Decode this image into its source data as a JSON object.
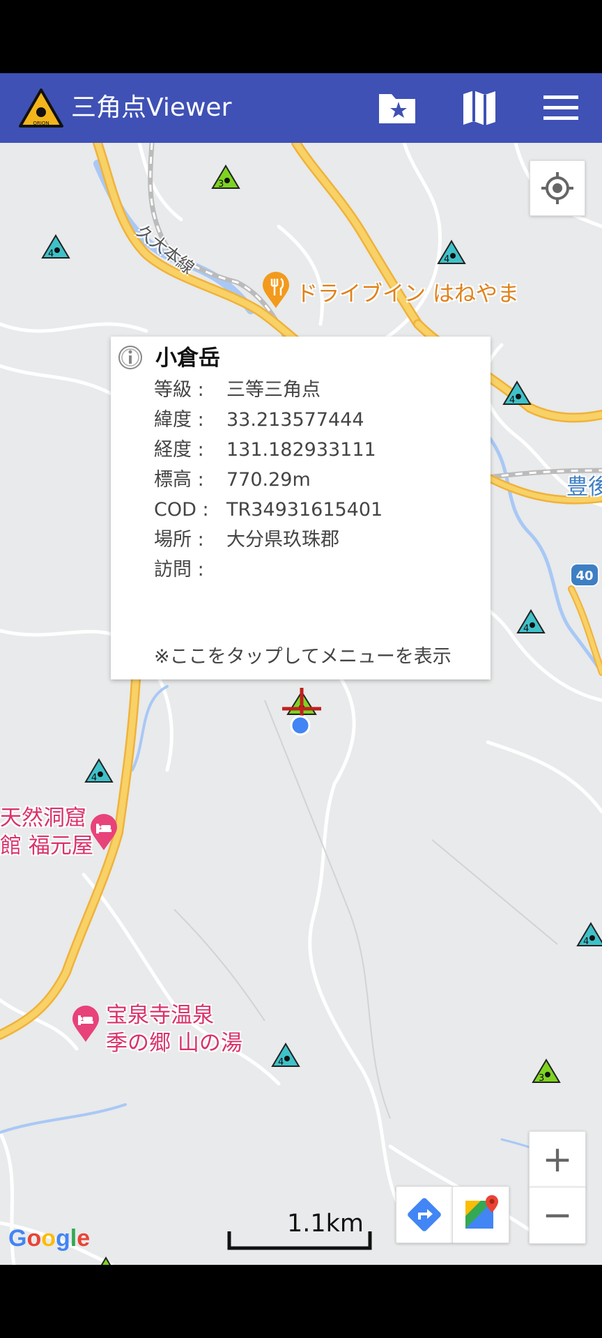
{
  "app": {
    "title": "三角点Viewer",
    "logo_text": "ORION",
    "icons": {
      "bookmarks": "folder-star-icon",
      "map": "map-icon",
      "menu": "hamburger-menu-icon"
    }
  },
  "map": {
    "poi": {
      "drive_in": "ドライブイン はねやま",
      "cave_line1": "天然洞窟",
      "cave_line2": "館 福元屋",
      "onsen_line1": "宝泉寺温泉",
      "onsen_line2": "季の郷 山の湯",
      "bungo": "豊後",
      "rail_line": "久大本線",
      "route_shield": "40"
    },
    "markers": [
      {
        "grade": "3",
        "color": "#7ed321"
      },
      {
        "grade": "4",
        "color": "#3fc1c9"
      },
      {
        "grade": "4",
        "color": "#3fc1c9"
      },
      {
        "grade": "4",
        "color": "#3fc1c9"
      },
      {
        "grade": "4",
        "color": "#3fc1c9"
      },
      {
        "grade": "4",
        "color": "#3fc1c9"
      },
      {
        "grade": "4",
        "color": "#3fc1c9"
      },
      {
        "grade": "4",
        "color": "#3fc1c9"
      },
      {
        "grade": "3",
        "color": "#7ed321"
      },
      {
        "grade": "3",
        "color": "#7ed321"
      }
    ],
    "scale_label": "1.1km",
    "attribution": "Google"
  },
  "info_window": {
    "title": "小倉岳",
    "rows": [
      {
        "key": "等級 :",
        "value": "三等三角点"
      },
      {
        "key": "緯度 :",
        "value": "33.213577444"
      },
      {
        "key": "経度 :",
        "value": "131.182933111"
      },
      {
        "key": "標高 :",
        "value": "770.29m"
      },
      {
        "key": "COD :",
        "value": "TR34931615401"
      },
      {
        "key": "場所 :",
        "value": "大分県玖珠郡"
      },
      {
        "key": "訪問 :",
        "value": ""
      }
    ],
    "note": "※ここをタップしてメニューを表示"
  },
  "controls": {
    "zoom_in": "+",
    "zoom_out": "−"
  },
  "colors": {
    "app_bar": "#3f51b5",
    "road_major": "#f6c64e",
    "water": "#a9c8f5",
    "marker_grade3": "#7ed321",
    "marker_grade4": "#3fc1c9",
    "cross": "#c0201e"
  }
}
